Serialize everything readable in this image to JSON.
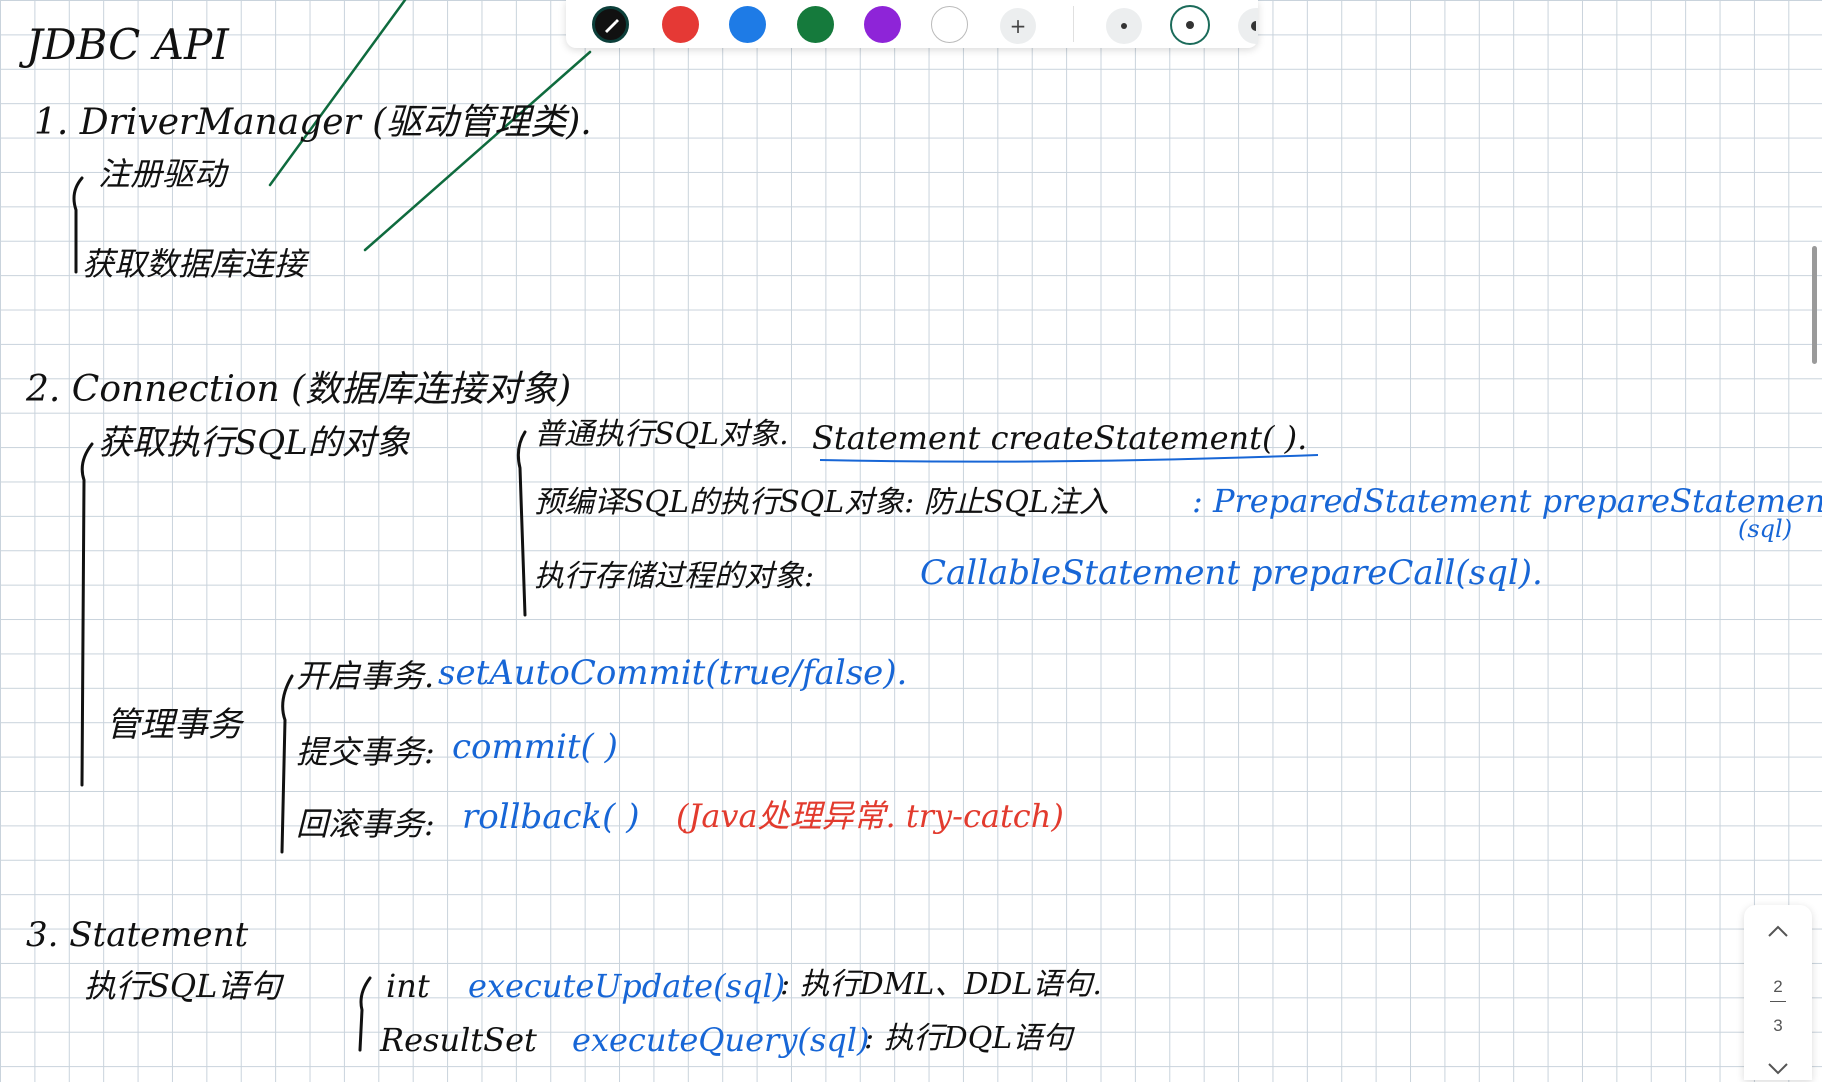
{
  "note": {
    "title": "JDBC API",
    "s1": {
      "heading": "1. DriverManager (驱动管理类).",
      "items": [
        "注册驱动",
        "获取数据库连接"
      ]
    },
    "s2": {
      "heading": "2. Connection (数据库连接对象)",
      "sub1_label": "获取执行SQL的对象",
      "rows": [
        {
          "label": "普通执行SQL对象.",
          "code": "Statement createStatement( )."
        },
        {
          "label": "预编译SQL的执行SQL对象: 防止SQL注入",
          "code": ": PreparedStatement prepareStatement",
          "code2": "(sql)"
        },
        {
          "label": "执行存储过程的对象:",
          "code": "CallableStatement prepareCall(sql)."
        }
      ],
      "sub2_label": "管理事务",
      "tx": [
        {
          "label": "开启事务.",
          "code": "setAutoCommit(true/false)."
        },
        {
          "label": "提交事务:",
          "code": "commit( )"
        },
        {
          "label": "回滚事务:",
          "code": "rollback( )",
          "note": "(Java处理异常. try-catch)"
        }
      ]
    },
    "s3": {
      "heading": "3. Statement",
      "label": "执行SQL语句",
      "rows": [
        {
          "type": "int",
          "code": "executeUpdate(sql)",
          "desc": ": 执行DML、DDL语句."
        },
        {
          "type": "ResultSet",
          "code": "executeQuery(sql)",
          "desc": ": 执行DQL语句"
        }
      ]
    }
  },
  "toolbar": {
    "pen_icon": "pen-icon",
    "colors": [
      "#111111",
      "#e53935",
      "#1e7be6",
      "#157a3c",
      "#8e24d8",
      "#ffffff"
    ],
    "add_label": "+"
  },
  "pager": {
    "current": "2",
    "total": "3"
  }
}
